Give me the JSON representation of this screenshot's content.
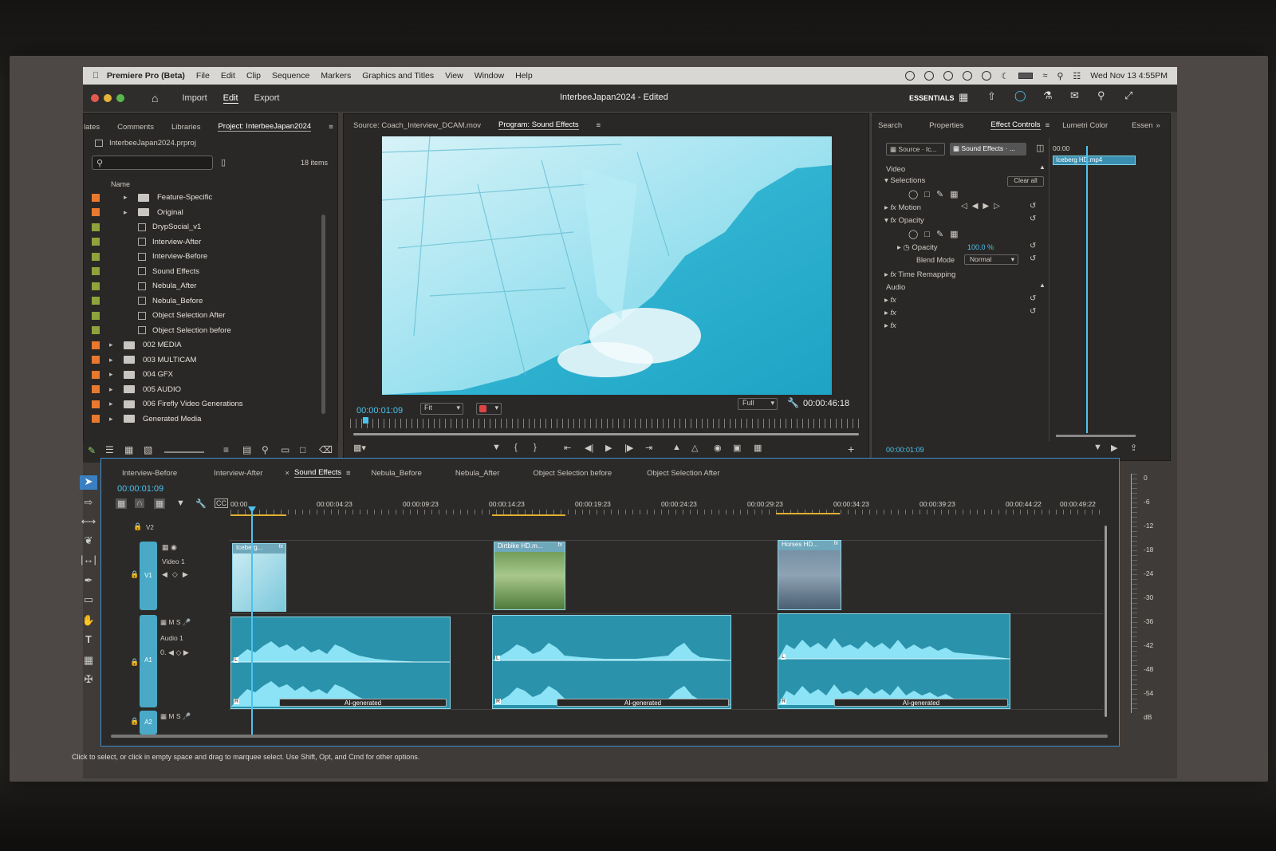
{
  "menubar": {
    "app_name": "Premiere Pro (Beta)",
    "items": [
      "File",
      "Edit",
      "Clip",
      "Sequence",
      "Markers",
      "Graphics and Titles",
      "View",
      "Window",
      "Help"
    ],
    "datetime": "Wed Nov 13  4:55PM"
  },
  "titlebar": {
    "tabs": [
      "Import",
      "Edit",
      "Export"
    ],
    "active_tab": "Edit",
    "doc_title": "InterbeeJapan2024 - Edited",
    "workspace": "ESSENTIALS"
  },
  "project": {
    "tabs": [
      "lates",
      "Comments",
      "Libraries",
      "Project: InterbeeJapan2024"
    ],
    "active_tab": "Project: InterbeeJapan2024",
    "file_name": "InterbeeJapan2024.prproj",
    "search_placeholder": "",
    "item_count": "18 items",
    "column_name": "Name",
    "items": [
      {
        "label": "Feature-Specific",
        "kind": "folder",
        "color": "#e8792e",
        "indent": 2
      },
      {
        "label": "Original",
        "kind": "folder",
        "color": "#e8792e",
        "indent": 2
      },
      {
        "label": "DrypSocial_v1",
        "kind": "sequence",
        "color": "#8fa33d",
        "indent": 3
      },
      {
        "label": "Interview-After",
        "kind": "sequence",
        "color": "#8fa33d",
        "indent": 3
      },
      {
        "label": "Interview-Before",
        "kind": "sequence",
        "color": "#8fa33d",
        "indent": 3
      },
      {
        "label": "Sound Effects",
        "kind": "sequence",
        "color": "#8fa33d",
        "indent": 3
      },
      {
        "label": "Nebula_After",
        "kind": "sequence",
        "color": "#8fa33d",
        "indent": 3
      },
      {
        "label": "Nebula_Before",
        "kind": "sequence",
        "color": "#8fa33d",
        "indent": 3
      },
      {
        "label": "Object Selection After",
        "kind": "sequence",
        "color": "#8fa33d",
        "indent": 3
      },
      {
        "label": "Object Selection before",
        "kind": "sequence",
        "color": "#8fa33d",
        "indent": 3
      },
      {
        "label": "002 MEDIA",
        "kind": "folder",
        "color": "#e8792e",
        "indent": 1
      },
      {
        "label": "003 MULTICAM",
        "kind": "folder",
        "color": "#e8792e",
        "indent": 1
      },
      {
        "label": "004 GFX",
        "kind": "folder",
        "color": "#e8792e",
        "indent": 1
      },
      {
        "label": "005 AUDIO",
        "kind": "folder",
        "color": "#e8792e",
        "indent": 1
      },
      {
        "label": "006 Firefly Video Generations",
        "kind": "folder",
        "color": "#e8792e",
        "indent": 1
      },
      {
        "label": "Generated Media",
        "kind": "folder",
        "color": "#e8792e",
        "indent": 1
      }
    ]
  },
  "monitor": {
    "source_tab": "Source: Coach_Interview_DCAM.mov",
    "program_tab": "Program: Sound Effects",
    "timecode": "00:00:01:09",
    "fit": "Fit",
    "quality": "Full",
    "duration": "00:00:46:18"
  },
  "effects": {
    "tabs": [
      "Search",
      "Properties",
      "Effect Controls",
      "Lumetri Color",
      "Essen"
    ],
    "active_tab": "Effect Controls",
    "source_chip": "Source · Ic...",
    "seq_chip": "Sound Effects · ...",
    "mini_timecode": "00:00",
    "mini_clip": "Iceberg HD.mp4",
    "video_label": "Video",
    "selections": "Selections",
    "clear_all": "Clear all",
    "motion": "Motion",
    "opacity": "Opacity",
    "opacity_prop": "Opacity",
    "opacity_value": "100.0 %",
    "blend_mode_label": "Blend Mode",
    "blend_mode": "Normal",
    "time_remap": "Time Remapping",
    "audio_label": "Audio",
    "fx": "fx",
    "timecode": "00:00:01:09"
  },
  "timeline": {
    "tabs": [
      "Interview-Before",
      "Interview-After",
      "Sound Effects",
      "Nebula_Before",
      "Nebula_After",
      "Object Selection before",
      "Object Selection After"
    ],
    "active_tab": "Sound Effects",
    "timecode": "00:00:01:09",
    "ruler": [
      "00:00",
      "00:00:04:23",
      "00:00:09:23",
      "00:00:14:23",
      "00:00:19:23",
      "00:00:24:23",
      "00:00:29:23",
      "00:00:34:23",
      "00:00:39:23",
      "00:00:44:22",
      "00:00:49:22"
    ],
    "tracks": {
      "v2": "V2",
      "v1": "V1",
      "v1_name": "Video 1",
      "a1": "A1",
      "a1_name": "Audio 1",
      "a2": "A2",
      "m": "M",
      "s": "S",
      "vol": "0."
    },
    "video_clips": [
      "Iceberg...",
      "Dirtbike HD.m...",
      "Horses HD..."
    ],
    "audio_badge": "AI-generated",
    "fx": "fx",
    "channel_l": "L",
    "channel_r": "R"
  },
  "meters": [
    "0",
    "-6",
    "-12",
    "-18",
    "-24",
    "-30",
    "-36",
    "-42",
    "-48",
    "-54",
    "dB"
  ],
  "status_bar": "Click to select, or click in empty space and drag to marquee select. Use Shift, Opt, and Cmd for other options.",
  "colors": {
    "accent": "#4cc3ef",
    "folder_label": "#e8792e",
    "sequence_label": "#8fa33d",
    "clip": "#2a92ab"
  }
}
